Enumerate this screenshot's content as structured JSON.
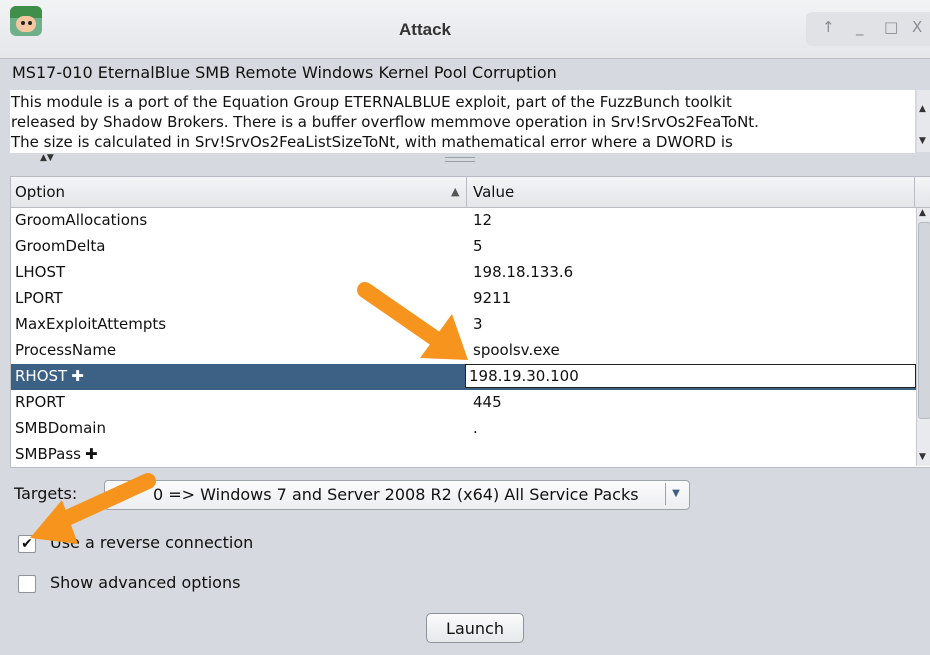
{
  "window": {
    "title": "Attack",
    "controls": [
      "↑",
      "_",
      "□",
      "X"
    ]
  },
  "module": {
    "name": "MS17-010 EternalBlue SMB Remote Windows Kernel Pool Corruption",
    "description_lines": [
      "This module is a port of the Equation Group ETERNALBLUE exploit, part of the FuzzBunch toolkit",
      "released by Shadow Brokers. There is a buffer overflow memmove operation in Srv!SrvOs2FeaToNt.",
      "The size is calculated in Srv!SrvOs2FeaListSizeToNt, with mathematical error where a DWORD is"
    ]
  },
  "table": {
    "headers": {
      "option": "Option",
      "value": "Value"
    },
    "rows": [
      {
        "option": "GroomAllocations",
        "value": "12",
        "required": false
      },
      {
        "option": "GroomDelta",
        "value": "5",
        "required": false
      },
      {
        "option": "LHOST",
        "value": "198.18.133.6",
        "required": false
      },
      {
        "option": "LPORT",
        "value": "9211",
        "required": false
      },
      {
        "option": "MaxExploitAttempts",
        "value": "3",
        "required": false
      },
      {
        "option": "ProcessName",
        "value": "spoolsv.exe",
        "required": false
      },
      {
        "option": "RHOST",
        "value": "198.19.30.100",
        "required": true,
        "selected": true
      },
      {
        "option": "RPORT",
        "value": "445",
        "required": false
      },
      {
        "option": "SMBDomain",
        "value": ".",
        "required": false
      },
      {
        "option": "SMBPass",
        "value": "",
        "required": true
      }
    ],
    "required_marker": "✚"
  },
  "targets": {
    "label": "Targets:",
    "selected": "0 => Windows 7 and Server 2008 R2 (x64) All Service Packs"
  },
  "options": {
    "reverse_connection": {
      "label": "Use a reverse connection",
      "checked": true
    },
    "advanced": {
      "label": "Show advanced options",
      "checked": false
    }
  },
  "launch_label": "Launch",
  "annotation_color": "#f7941d",
  "selection_color": "#3d6185"
}
